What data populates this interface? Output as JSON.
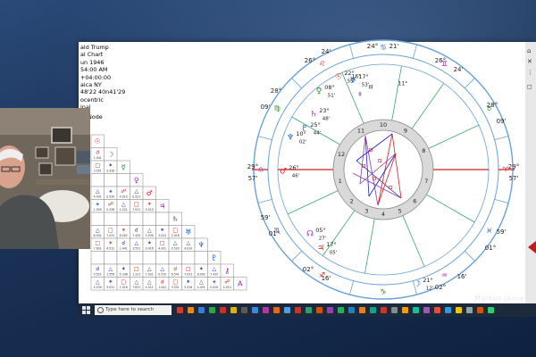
{
  "info_panel": {
    "lines": [
      "ald Trump",
      "al Chart",
      "un 1946",
      "54:00 AM",
      "+04:00:00",
      "aica NY",
      "48'22 40n41'29",
      "ocentric",
      "ipal"
    ],
    "node_label": "Node"
  },
  "aspect_grid": {
    "row_glyphs": [
      "☉",
      "☽",
      "☿",
      "♀",
      "♂",
      "♃",
      "♄",
      "♅",
      "♆",
      "♇",
      "⚷",
      "A"
    ],
    "cell_texts": [
      "1.441",
      "3.551",
      "3.416",
      "4.431",
      "0.520",
      "4.010",
      "0.521",
      "1.559",
      "5.336",
      "1.221",
      "7.031",
      "0.510",
      "6.541",
      "7.031",
      "6.002",
      "7.425",
      "5.030",
      "3.031",
      "2.016",
      "7.631",
      "4.512"
    ]
  },
  "chart": {
    "zodiac_signs": [
      "♈",
      "♉",
      "♊",
      "♋",
      "♌",
      "♍",
      "♎",
      "♏",
      "♐",
      "♑",
      "♒",
      "♓"
    ],
    "degree_labels": [
      "24°",
      "21'",
      "26°",
      "24'",
      "28°",
      "09'",
      "29°",
      "57'",
      "59'",
      "01°",
      "02°",
      "16'",
      "26°",
      "24'",
      "28°",
      "09'",
      "29°",
      "57'",
      "59'",
      "01°",
      "02°",
      "16'"
    ],
    "house_numbers": [
      "1",
      "2",
      "3",
      "4",
      "5",
      "6",
      "7",
      "8",
      "9",
      "10",
      "11",
      "12"
    ],
    "planets": [
      {
        "glyph": "☉",
        "deg": "22°",
        "min": "55'"
      },
      {
        "glyph": "♅",
        "deg": "17°",
        "min": "53'"
      },
      {
        "glyph": "♀",
        "deg": "08°",
        "min": "51'"
      },
      {
        "glyph": "♄",
        "deg": "23°",
        "min": "48'"
      },
      {
        "glyph": "♇",
        "deg": "25°",
        "min": "44'"
      },
      {
        "glyph": "♆",
        "deg": "10°",
        "min": "02'"
      },
      {
        "glyph": "♂",
        "deg": "26°",
        "min": "46'"
      },
      {
        "glyph": "☽",
        "deg": "21°",
        "min": "12'"
      },
      {
        "glyph": "♃",
        "deg": "17°",
        "min": "05'"
      },
      {
        "glyph": "☊",
        "deg": "05°",
        "min": "27'"
      }
    ],
    "misc_texts": [
      "16°",
      "11°",
      "III",
      "II",
      "IX",
      "XI",
      "I",
      "XII"
    ]
  },
  "taskbar": {
    "search_placeholder": "Type here to search",
    "app_colors": [
      "#d23b2f",
      "#e48b1d",
      "#3a7bd5",
      "#2ea44f",
      "#c9302c",
      "#d9b21a",
      "#5a5a5a",
      "#3f86e0",
      "#b03aa5",
      "#e06b1f",
      "#4aa3df",
      "#c0392b",
      "#2f9e6f",
      "#d35400",
      "#8e44ad",
      "#27ae60",
      "#2980b9",
      "#e67e22",
      "#16a085",
      "#c0392b",
      "#7f8c8d",
      "#f39c12",
      "#1abc9c",
      "#9b59b6",
      "#e74c3c",
      "#3498db",
      "#f1c40f",
      "#95a5a6",
      "#d35400",
      "#2ecc71"
    ]
  },
  "watermark": "Markus Janse",
  "colors": {
    "fire": "#e21b1b",
    "earth": "#1a8f1a",
    "air": "#9a2aa8",
    "water": "#1a5fcf",
    "ring_blue": "#6aa2d8",
    "house_green": "#3aa86b",
    "aspect_red": "#d02020",
    "aspect_blue": "#2020c8",
    "aspect_purple": "#8b3fb3"
  }
}
